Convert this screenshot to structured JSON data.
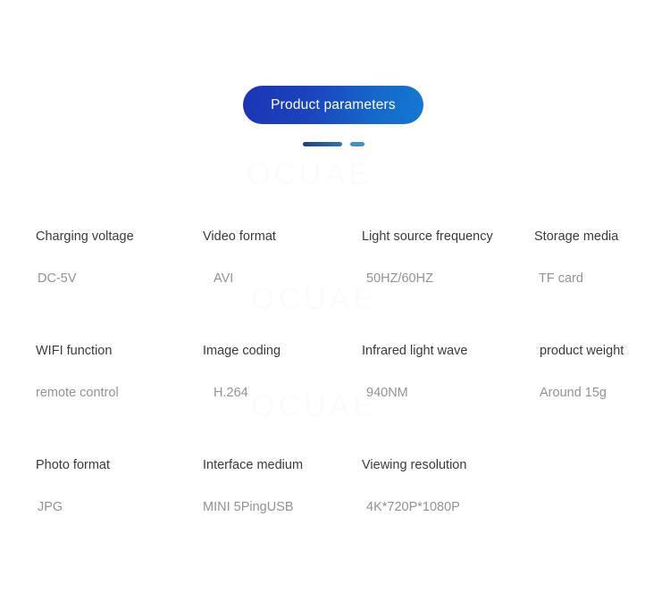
{
  "header": {
    "button_label": "Product parameters",
    "accent_dark": "#1d34b4",
    "accent_light": "#1379d2",
    "dash_long_color": "#1b3f84",
    "dash_short_color": "#3f92c6"
  },
  "watermark": {
    "text": "OCUAE",
    "color": "#fbfbfb"
  },
  "specs": {
    "label_color": "#3b3b3b",
    "value_color": "#939393",
    "rows": [
      [
        {
          "label": "Charging voltage",
          "value": "DC-5V"
        },
        {
          "label": "Video format",
          "value": "AVI"
        },
        {
          "label": "Light source frequency",
          "value": "50HZ/60HZ"
        },
        {
          "label": "Storage media",
          "value": "TF card"
        }
      ],
      [
        {
          "label": "WIFI function",
          "value": "remote control"
        },
        {
          "label": "Image coding",
          "value": "H.264"
        },
        {
          "label": "Infrared light wave",
          "value": "940NM"
        },
        {
          "label": "product weight",
          "value": "Around 15g"
        }
      ],
      [
        {
          "label": "Photo format",
          "value": "JPG"
        },
        {
          "label": "Interface medium",
          "value": "MINI 5PingUSB"
        },
        {
          "label": "Viewing resolution",
          "value": "4K*720P*1080P"
        }
      ]
    ]
  }
}
